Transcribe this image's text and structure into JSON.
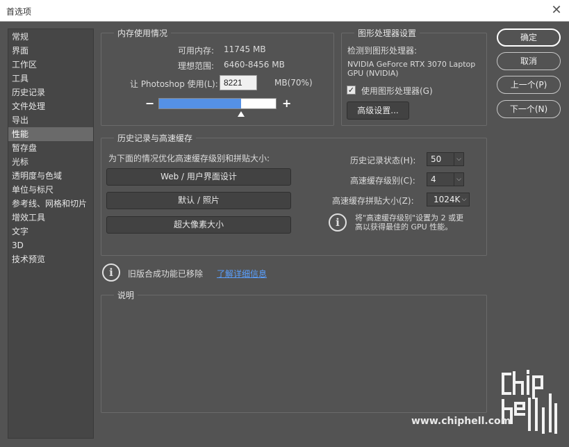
{
  "window": {
    "title": "首选项"
  },
  "sidebar": {
    "items": [
      {
        "label": "常规"
      },
      {
        "label": "界面"
      },
      {
        "label": "工作区"
      },
      {
        "label": "工具"
      },
      {
        "label": "历史记录"
      },
      {
        "label": "文件处理"
      },
      {
        "label": "导出"
      },
      {
        "label": "性能",
        "selected": true
      },
      {
        "label": "暂存盘"
      },
      {
        "label": "光标"
      },
      {
        "label": "透明度与色域"
      },
      {
        "label": "单位与标尺"
      },
      {
        "label": "参考线、网格和切片"
      },
      {
        "label": "增效工具"
      },
      {
        "label": "文字"
      },
      {
        "label": "3D"
      },
      {
        "label": "技术预览"
      }
    ]
  },
  "memory": {
    "title": "内存使用情况",
    "available_label": "可用内存:",
    "available_value": "11745 MB",
    "ideal_label": "理想范围:",
    "ideal_value": "6460-8456 MB",
    "use_label": "让 Photoshop 使用(L):",
    "use_value": "8221",
    "use_unit": "MB(70%)",
    "minus": "−",
    "plus": "+",
    "slider_fraction": 0.7
  },
  "gpu": {
    "title": "图形处理器设置",
    "detected_label": "检测到图形处理器:",
    "detected_line1": "NVIDIA GeForce RTX 3070 Laptop",
    "detected_line2": "GPU (NVIDIA)",
    "use_gpu_label": "使用图形处理器(G)",
    "use_gpu_checked": "✓",
    "advanced_button": "高级设置..."
  },
  "history_cache": {
    "title": "历史记录与高速缓存",
    "optimize_label": "为下面的情况优化高速缓存级别和拼贴大小:",
    "btn_web": "Web / 用户界面设计",
    "btn_default": "默认 / 照片",
    "btn_huge": "超大像素大小",
    "history_states_label": "历史记录状态(H):",
    "history_states_value": "50",
    "cache_levels_label": "高速缓存级别(C):",
    "cache_levels_value": "4",
    "tile_size_label": "高速缓存拼贴大小(Z):",
    "tile_size_value": "1024K",
    "info_line1": "将\"高速缓存级别\"设置为 2 或更",
    "info_line2": "高以获得最佳的 GPU 性能。"
  },
  "legacy": {
    "text": "旧版合成功能已移除",
    "link": "了解详细信息"
  },
  "description": {
    "title": "说明"
  },
  "buttons": {
    "ok": "确定",
    "cancel": "取消",
    "prev": "上一个(P)",
    "next": "下一个(N)"
  },
  "icons": {
    "info": "i",
    "close": "✕",
    "chevron": "⌵"
  },
  "watermark": {
    "text": "www.chiphell.com",
    "logo_text": "chip hell"
  }
}
